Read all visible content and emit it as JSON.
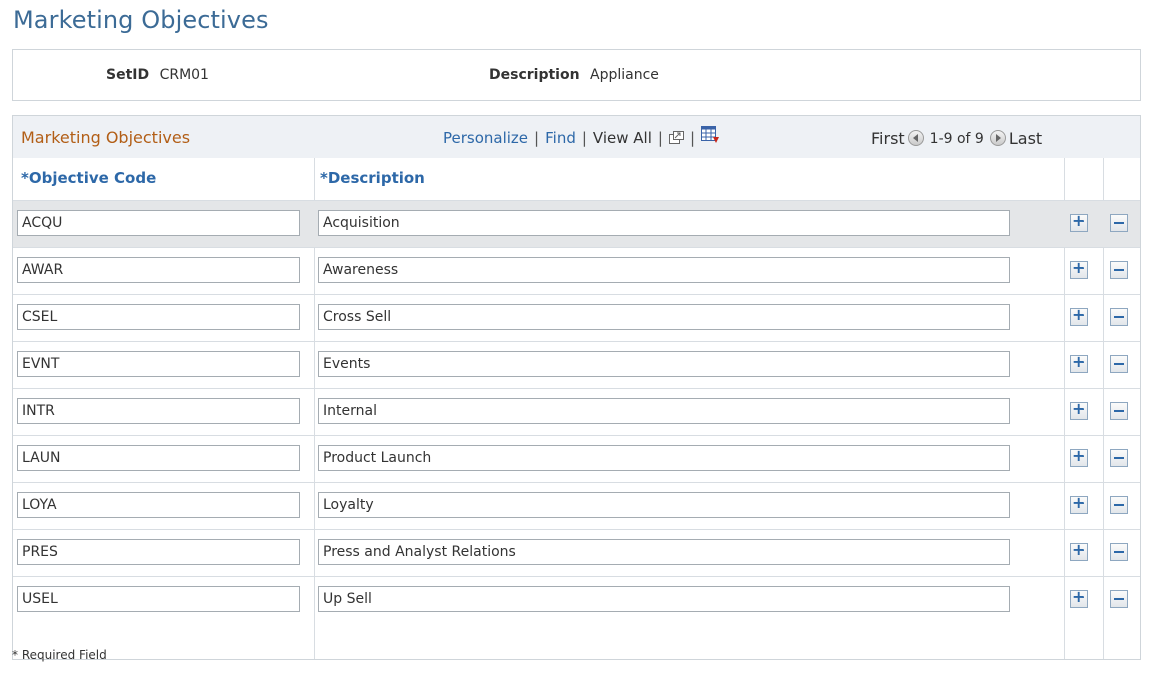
{
  "page": {
    "title": "Marketing Objectives"
  },
  "header": {
    "setid_label": "SetID",
    "setid_value": "CRM01",
    "description_label": "Description",
    "description_value": "Appliance"
  },
  "grid": {
    "title": "Marketing Objectives",
    "nav": {
      "personalize": "Personalize",
      "find": "Find",
      "view_all": "View All",
      "separator": "|",
      "zoom_icon": "zoom-window-icon",
      "download_icon": "download-spreadsheet-icon"
    },
    "pager": {
      "first": "First",
      "range": "1-9 of 9",
      "last": "Last",
      "prev_icon": "previous-arrow-icon",
      "next_icon": "next-arrow-icon"
    },
    "columns": {
      "code": "*Objective Code",
      "description": "*Description"
    },
    "rows": [
      {
        "code": "ACQU",
        "description": "Acquisition"
      },
      {
        "code": "AWAR",
        "description": "Awareness"
      },
      {
        "code": "CSEL",
        "description": "Cross Sell"
      },
      {
        "code": "EVNT",
        "description": "Events"
      },
      {
        "code": "INTR",
        "description": "Internal"
      },
      {
        "code": "LAUN",
        "description": "Product Launch"
      },
      {
        "code": "LOYA",
        "description": "Loyalty"
      },
      {
        "code": "PRES",
        "description": "Press and Analyst Relations"
      },
      {
        "code": "USEL",
        "description": "Up Sell"
      }
    ],
    "add_row_icon": "add-row-icon",
    "delete_row_icon": "delete-row-icon"
  },
  "footnote": "* Required Field",
  "colors": {
    "title": "#3c6b96",
    "link": "#2d68a8",
    "grid_title": "#b25e16",
    "titlebar_bg": "#eef1f5",
    "selected_row_bg": "#e4e6e8"
  }
}
